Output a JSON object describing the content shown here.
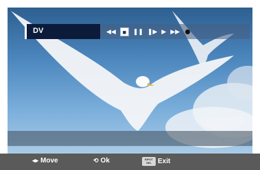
{
  "osd": {
    "source": "DV",
    "controls": [
      {
        "name": "rewind-icon",
        "glyph": "◀◀"
      },
      {
        "name": "stop-icon",
        "glyph": "■"
      },
      {
        "name": "pause-icon",
        "glyph": "❚❚"
      },
      {
        "name": "step-icon",
        "glyph": "❚▶"
      },
      {
        "name": "play-icon",
        "glyph": "▶"
      },
      {
        "name": "fast-forward-icon",
        "glyph": "▶▶"
      },
      {
        "name": "record-icon",
        "glyph": "●"
      }
    ],
    "active_control": "stop-icon"
  },
  "footer": {
    "move_icon": "◂▸",
    "move_label": "Move",
    "ok_icon": "⟲",
    "ok_label": "Ok",
    "exit_key_line1": "INPUT",
    "exit_key_line2": "SEL",
    "exit_label": "Exit"
  },
  "colors": {
    "source_box": "#0c1b3a",
    "footer": "#5a5a5a"
  }
}
